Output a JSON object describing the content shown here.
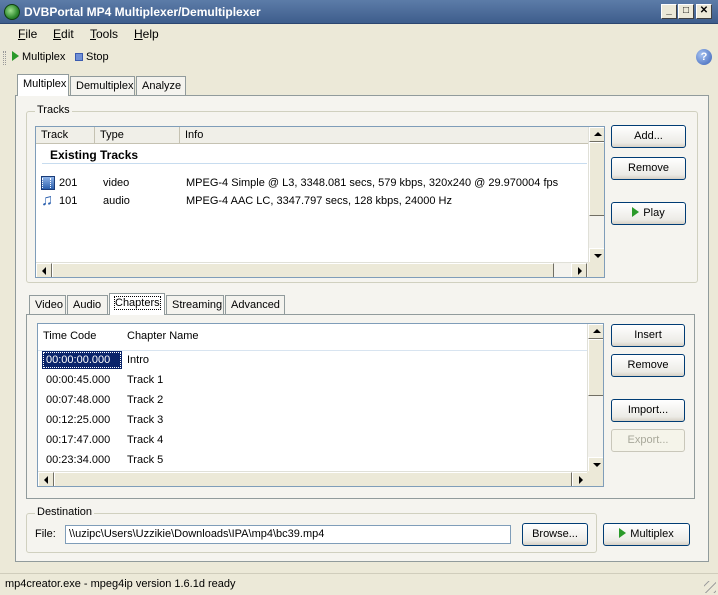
{
  "window": {
    "title": "DVBPortal MP4 Multiplexer/Demultiplexer",
    "min": "_",
    "max": "□",
    "close": "✕"
  },
  "menu": [
    {
      "first": "F",
      "rest": "ile"
    },
    {
      "first": "E",
      "rest": "dit"
    },
    {
      "first": "T",
      "rest": "ools"
    },
    {
      "first": "H",
      "rest": "elp"
    }
  ],
  "toolbar": {
    "multiplex_label": "Multiplex",
    "stop_label": "Stop",
    "help_glyph": "?"
  },
  "main_tabs": [
    "Multiplex",
    "Demultiplex",
    "Analyze"
  ],
  "tracks": {
    "group_label": "Tracks",
    "columns": [
      "Track",
      "Type",
      "Info"
    ],
    "group_heading": "Existing Tracks",
    "rows": [
      {
        "icon": "video-track-icon",
        "track": "201",
        "type": "video",
        "info": "MPEG-4 Simple @ L3, 3348.081 secs, 579 kbps, 320x240 @ 29.970004 fps"
      },
      {
        "icon": "audio-track-icon",
        "track": "101",
        "type": "audio",
        "info": "MPEG-4 AAC LC, 3347.797 secs, 128 kbps, 24000 Hz"
      }
    ],
    "buttons": {
      "add": "Add...",
      "remove": "Remove",
      "play": "Play"
    }
  },
  "sub_tabs": [
    "Video",
    "Audio",
    "Chapters",
    "Streaming",
    "Advanced"
  ],
  "chapters": {
    "columns": [
      "Time Code",
      "Chapter Name"
    ],
    "rows": [
      {
        "time": "00:00:00.000",
        "name": "Intro"
      },
      {
        "time": "00:00:45.000",
        "name": "Track 1"
      },
      {
        "time": "00:07:48.000",
        "name": "Track 2"
      },
      {
        "time": "00:12:25.000",
        "name": "Track 3"
      },
      {
        "time": "00:17:47.000",
        "name": "Track 4"
      },
      {
        "time": "00:23:34.000",
        "name": "Track 5"
      }
    ],
    "buttons": {
      "insert": "Insert",
      "remove": "Remove",
      "import": "Import...",
      "export": "Export..."
    }
  },
  "destination": {
    "group_label": "Destination",
    "file_label": "File:",
    "file_value": "\\\\uzipc\\Users\\Uzzikie\\Downloads\\IPA\\mp4\\bc39.mp4",
    "browse_label": "Browse...",
    "multiplex_label": "Multiplex"
  },
  "status": {
    "text": "mp4creator.exe - mpeg4ip version 1.6.1d ready"
  }
}
